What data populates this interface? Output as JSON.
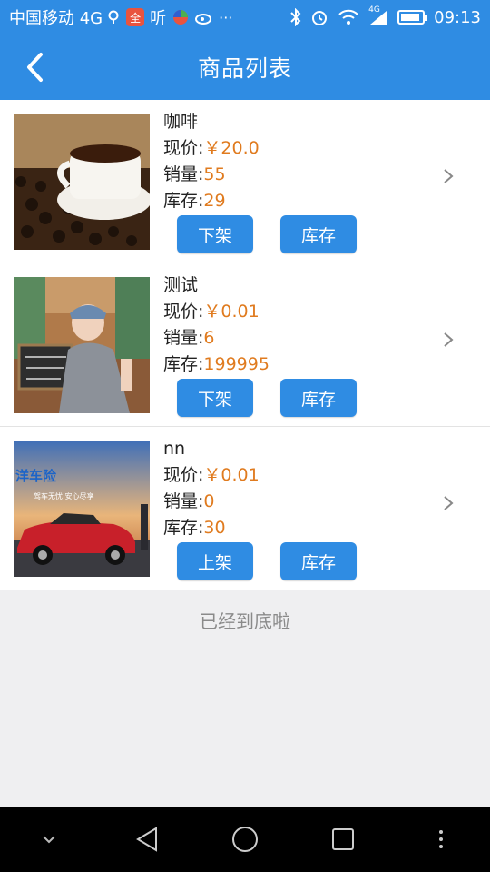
{
  "status_bar": {
    "carrier": "中国移动 4G",
    "notif_badge": "全",
    "ting": "听",
    "time": "09:13",
    "net": "4G",
    "icons": [
      "search-icon",
      "app-icon",
      "weibo-icon",
      "more-icon",
      "bluetooth-icon",
      "alarm-icon",
      "wifi-icon",
      "signal-icon",
      "battery-icon"
    ],
    "battery_level": 0.9
  },
  "header": {
    "title": "商品列表",
    "back_icon": "back-arrow-icon"
  },
  "labels": {
    "price": "现价:",
    "sales": "销量:",
    "stock": "库存:"
  },
  "products": [
    {
      "name": "咖啡",
      "price": "￥20.0",
      "sales": "55",
      "stock": "29",
      "action_label": "下架",
      "stock_button_label": "库存",
      "image": "coffee-photo"
    },
    {
      "name": "测试",
      "price": "￥0.01",
      "sales": "6",
      "stock": "199995",
      "action_label": "下架",
      "stock_button_label": "库存",
      "image": "person-photo"
    },
    {
      "name": "nn",
      "price": "￥0.01",
      "sales": "0",
      "stock": "30",
      "action_label": "上架",
      "stock_button_label": "库存",
      "image": "car-insurance-photo",
      "image_text": "洋车险",
      "image_subtext": "驾车无忧 安心尽享"
    }
  ],
  "footer": {
    "end_text": "已经到底啦"
  },
  "colors": {
    "primary": "#2f8ce3",
    "price": "#e07b1f",
    "background": "#efeff1"
  }
}
